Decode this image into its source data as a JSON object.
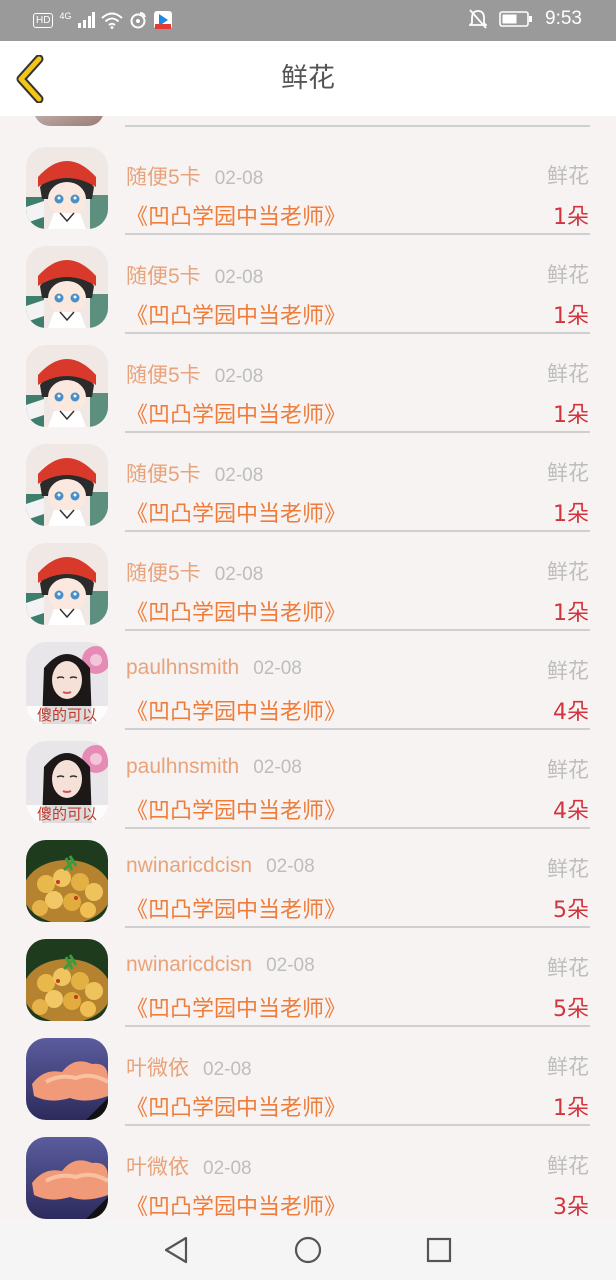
{
  "status_bar": {
    "network": "HD",
    "signal": "4G",
    "time": "9:53"
  },
  "header": {
    "title": "鲜花"
  },
  "records": [
    {
      "user": "随便5卡",
      "date": "02-08",
      "type": "鲜花",
      "book": "《凹凸学园中当老师》",
      "count": "1朵",
      "avatar": "anime"
    },
    {
      "user": "随便5卡",
      "date": "02-08",
      "type": "鲜花",
      "book": "《凹凸学园中当老师》",
      "count": "1朵",
      "avatar": "anime"
    },
    {
      "user": "随便5卡",
      "date": "02-08",
      "type": "鲜花",
      "book": "《凹凸学园中当老师》",
      "count": "1朵",
      "avatar": "anime"
    },
    {
      "user": "随便5卡",
      "date": "02-08",
      "type": "鲜花",
      "book": "《凹凸学园中当老师》",
      "count": "1朵",
      "avatar": "anime"
    },
    {
      "user": "随便5卡",
      "date": "02-08",
      "type": "鲜花",
      "book": "《凹凸学园中当老师》",
      "count": "1朵",
      "avatar": "anime"
    },
    {
      "user": "paulhnsmith",
      "date": "02-08",
      "type": "鲜花",
      "book": "《凹凸学园中当老师》",
      "count": "4朵",
      "avatar": "portrait",
      "avatar_caption": "傻的可以"
    },
    {
      "user": "paulhnsmith",
      "date": "02-08",
      "type": "鲜花",
      "book": "《凹凸学园中当老师》",
      "count": "4朵",
      "avatar": "portrait",
      "avatar_caption": "傻的可以"
    },
    {
      "user": "nwinaricdcisn",
      "date": "02-08",
      "type": "鲜花",
      "book": "《凹凸学园中当老师》",
      "count": "5朵",
      "avatar": "food"
    },
    {
      "user": "nwinaricdcisn",
      "date": "02-08",
      "type": "鲜花",
      "book": "《凹凸学园中当老师》",
      "count": "5朵",
      "avatar": "food"
    },
    {
      "user": "叶微依",
      "date": "02-08",
      "type": "鲜花",
      "book": "《凹凸学园中当老师》",
      "count": "1朵",
      "avatar": "sky"
    },
    {
      "user": "叶微依",
      "date": "02-08",
      "type": "鲜花",
      "book": "《凹凸学园中当老师》",
      "count": "3朵",
      "avatar": "sky"
    }
  ],
  "colors": {
    "accent": "#f2c618",
    "username": "#e8a37a",
    "book_title": "#ee7c3a",
    "count": "#d0343c",
    "muted": "#bdbdbd"
  }
}
